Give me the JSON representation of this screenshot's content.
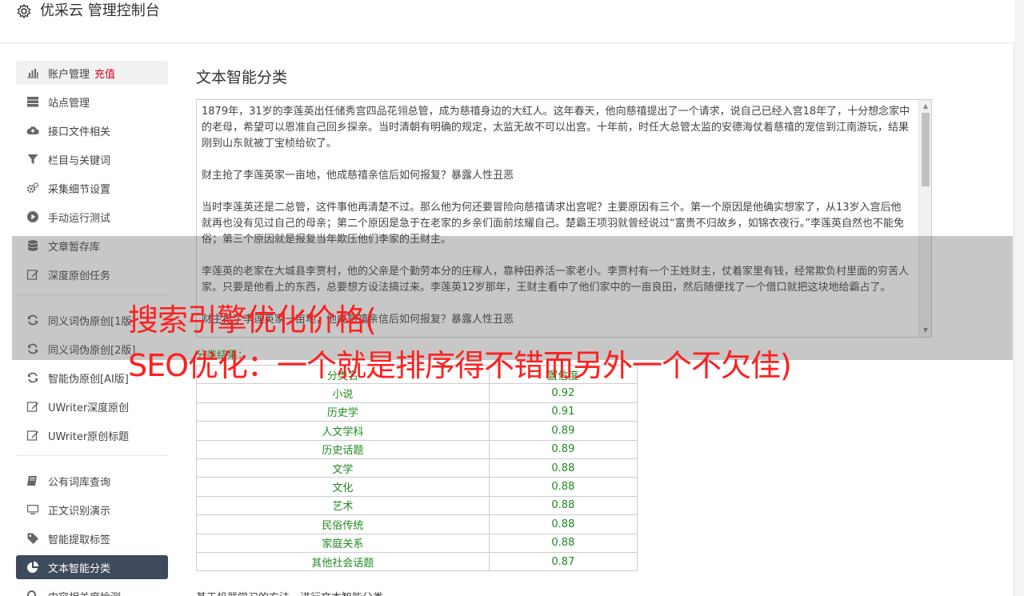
{
  "app": {
    "title": "优采云 管理控制台"
  },
  "sidebar": {
    "items": [
      {
        "label": "账户管理",
        "badge": "充值",
        "icon": "bar-chart-icon"
      },
      {
        "label": "站点管理",
        "icon": "server-icon"
      },
      {
        "label": "接口文件相关",
        "icon": "cloud-upload-icon"
      },
      {
        "label": "栏目与关键词",
        "icon": "filter-icon"
      },
      {
        "label": "采集细节设置",
        "icon": "cogs-icon"
      },
      {
        "label": "手动运行测试",
        "icon": "play-circle-icon"
      },
      {
        "label": "文章暂存库",
        "icon": "database-icon"
      },
      {
        "label": "深度原创任务",
        "icon": "edit-icon"
      },
      {
        "label": "同义词伪原创[1版]",
        "icon": "refresh-icon"
      },
      {
        "label": "同义词伪原创[2版]",
        "icon": "refresh-icon"
      },
      {
        "label": "智能伪原创[AI版]",
        "icon": "refresh-icon"
      },
      {
        "label": "UWriter深度原创",
        "icon": "edit-icon"
      },
      {
        "label": "UWriter原创标题",
        "icon": "edit-icon"
      },
      {
        "label": "公有词库查询",
        "icon": "book-icon"
      },
      {
        "label": "正文识别演示",
        "icon": "monitor-icon"
      },
      {
        "label": "智能提取标签",
        "icon": "tag-icon"
      },
      {
        "label": "文本智能分类",
        "icon": "pie-chart-icon"
      },
      {
        "label": "内容相关度检测",
        "icon": "search-icon"
      }
    ]
  },
  "main": {
    "title": "文本智能分类",
    "article_text": "1879年，31岁的李莲英出任储秀宫四品花翎总管，成为慈禧身边的大红人。这年春天，他向慈禧提出了一个请求，说自己已经入宫18年了，十分想念家中的老母，希望可以恩准自己回乡探亲。当时清朝有明确的规定，太监无故不可以出宫。十年前，时任大总管太监的安德海仗着慈禧的宠信到江南游玩，结果刚到山东就被丁宝桢给砍了。\n\n财主抢了李莲英家一亩地，他成慈禧亲信后如何报复？暴露人性丑恶\n\n当时李莲英还是二总管，这件事他再清楚不过。那么他为何还要冒险向慈禧请求出宫呢？主要原因有三个。第一个原因是他确实想家了，从13岁入宫后他就再也没有见过自己的母亲；第二个原因是急于在老家的乡亲们面前炫耀自己。楚霸王项羽就曾经说过“富贵不归故乡，如锦衣夜行。”李莲英自然也不能免俗；第三个原因就是报复当年欺压他们李家的王财主。\n\n李莲英的老家在大城县李贾村，他的父亲是个勤劳本分的庄稼人，靠种田养活一家老小。李贾村有一个王姓财主，仗着家里有钱，经常欺负村里面的穷苦人家。只要是他看上的东西，总要想方设法搞过来。李莲英12岁那年，王财主看中了他们家中的一亩良田，然后随便找了一个借口就把这块地给霸占了。\n\n财主抢了李莲英家一亩地，他成慈禧亲信后如何报复？暴露人性丑恶",
    "result_label": "分类结果：",
    "table": {
      "headers": [
        "分类名",
        "置信度"
      ],
      "rows": [
        [
          "小说",
          "0.92"
        ],
        [
          "历史学",
          "0.91"
        ],
        [
          "人文学科",
          "0.89"
        ],
        [
          "历史话题",
          "0.89"
        ],
        [
          "文学",
          "0.88"
        ],
        [
          "文化",
          "0.88"
        ],
        [
          "艺术",
          "0.88"
        ],
        [
          "民俗传统",
          "0.88"
        ],
        [
          "家庭关系",
          "0.88"
        ],
        [
          "其他社会话题",
          "0.87"
        ]
      ]
    },
    "footnote": "基于机器学习的方法，进行文本智能分类。"
  },
  "overlay": {
    "line1": "搜索引擎优化价格(",
    "line2": "SEO优化：一个就是排序得不错而另外一个不欠佳)"
  },
  "colors": {
    "active_bg": "#3f4a5c",
    "result_green": "#1f8a1f",
    "recharge_red": "#d9001b",
    "promo_red": "#ff1f1f"
  }
}
